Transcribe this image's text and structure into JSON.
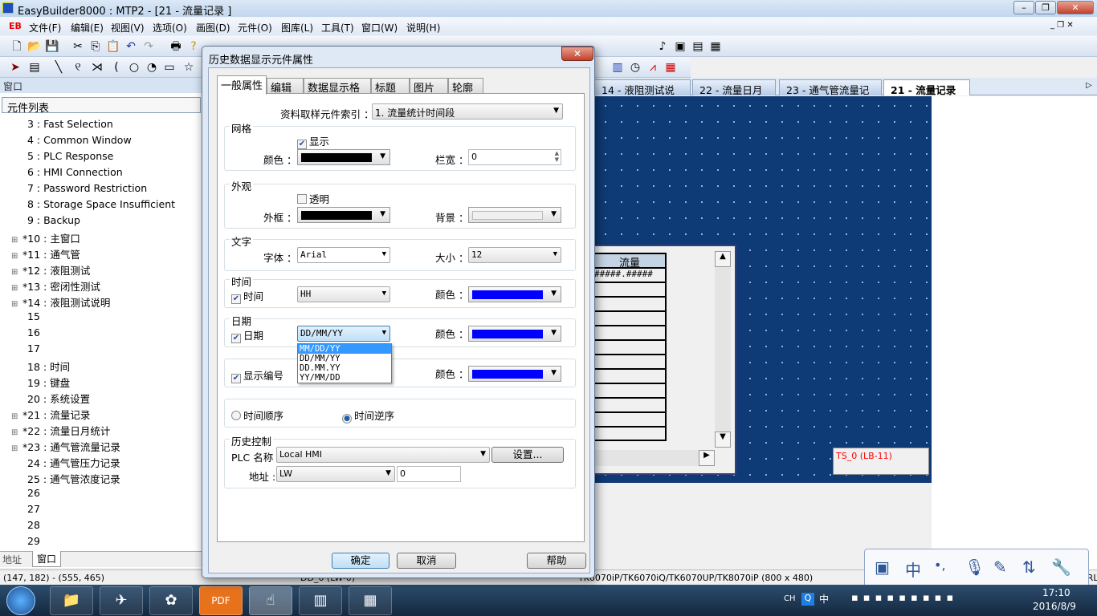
{
  "app": {
    "title": "EasyBuilder8000 : MTP2 - [21 - 流量记录 ]",
    "win_min": "–",
    "win_restore": "❐",
    "win_close": "✕",
    "logo": "EB"
  },
  "menu": [
    "文件(F)",
    "编辑(E)",
    "视图(V)",
    "选项(O)",
    "画图(D)",
    "元件(O)",
    "图库(L)",
    "工具(T)",
    "窗口(W)",
    "说明(H)"
  ],
  "left_panel": {
    "header": "窗口",
    "subheader": "元件列表",
    "bottom_tabs": [
      "地址",
      "窗口"
    ],
    "tree": [
      {
        "label": "3 : Fast Selection",
        "exp": false
      },
      {
        "label": "4 : Common Window",
        "exp": false
      },
      {
        "label": "5 : PLC Response",
        "exp": false
      },
      {
        "label": "6 : HMI Connection",
        "exp": false
      },
      {
        "label": "7 : Password Restriction",
        "exp": false
      },
      {
        "label": "8 : Storage Space Insufficient",
        "exp": false
      },
      {
        "label": "9 : Backup",
        "exp": false
      },
      {
        "label": "*10 : 主窗口",
        "exp": true
      },
      {
        "label": "*11 : 通气管",
        "exp": true
      },
      {
        "label": "*12 : 液阻测试",
        "exp": true
      },
      {
        "label": "*13 : 密闭性测试",
        "exp": true
      },
      {
        "label": "*14 : 液阻测试说明",
        "exp": true
      },
      {
        "label": "15",
        "exp": false
      },
      {
        "label": "16",
        "exp": false
      },
      {
        "label": "17",
        "exp": false
      },
      {
        "label": "18 : 时间",
        "exp": false
      },
      {
        "label": "19 : 键盘",
        "exp": false
      },
      {
        "label": "20 : 系统设置",
        "exp": false
      },
      {
        "label": "*21 : 流量记录",
        "exp": true
      },
      {
        "label": "*22 : 流量日月统计",
        "exp": true
      },
      {
        "label": "*23 : 通气管流量记录",
        "exp": true
      },
      {
        "label": "24 : 通气管压力记录",
        "exp": false
      },
      {
        "label": "25 : 通气管浓度记录",
        "exp": false
      },
      {
        "label": "26",
        "exp": false
      },
      {
        "label": "27",
        "exp": false
      },
      {
        "label": "28",
        "exp": false
      },
      {
        "label": "29",
        "exp": false
      }
    ]
  },
  "doc_tabs": [
    "14 - 液阻测试说明",
    "22 - 流量日月统计",
    "23 - 通气管流量记录",
    "21 - 流量记录"
  ],
  "doc_tab_close": "✕",
  "canvas": {
    "table_header": "流量",
    "table_value": "#####.#####",
    "ts_label": "TS_0 (LB-11)",
    "ts_color": "#ff0000",
    "bg": "#0e3a75"
  },
  "dialog": {
    "title": "历史数据显示元件属性",
    "close": "✕",
    "tabs": [
      "一般属性",
      "编辑",
      "数据显示格式",
      "标题",
      "图片",
      "轮廓"
    ],
    "sampling_label": "资料取样元件索引 ：",
    "sampling_value": "1.  流量统计时间段",
    "grid": {
      "title": "网格",
      "show": "显示",
      "show_checked": true,
      "color_label": "颜色 ：",
      "color": "#000000",
      "width_label": "栏宽 ：",
      "width_value": "0"
    },
    "appearance": {
      "title": "外观",
      "transparent": "透明",
      "transparent_checked": false,
      "frame_label": "外框 ：",
      "frame_color": "#000000",
      "bg_label": "背景 ：",
      "bg_color": "#f0f0f0"
    },
    "text": {
      "title": "文字",
      "font_label": "字体 ：",
      "font_value": "Arial",
      "size_label": "大小 ：",
      "size_value": "12"
    },
    "time": {
      "title": "时间",
      "check": "时间",
      "checked": true,
      "format": "HH",
      "color_label": "颜色 ：",
      "color": "#0000ff"
    },
    "date": {
      "title": "日期",
      "check": "日期",
      "checked": true,
      "format": "DD/MM/YY",
      "color_label": "颜色 ：",
      "color": "#0000ff",
      "options": [
        "MM/DD/YY",
        "DD/MM/YY",
        "DD.MM.YY",
        "YY/MM/DD"
      ],
      "highlighted": "MM/DD/YY"
    },
    "number": {
      "check": "显示编号",
      "checked": true,
      "color_label": "颜色 ：",
      "color": "#0000ff"
    },
    "order": {
      "asc": "时间顺序",
      "desc": "时间逆序",
      "selected": "时间逆序"
    },
    "history": {
      "title": "历史控制",
      "plc_label": "PLC 名称 :",
      "plc_value": "Local HMI",
      "settings_btn": "设置...",
      "addr_label": "地址 :",
      "addr_type": "LW",
      "addr_value": "0"
    },
    "ok": "确定",
    "cancel": "取消",
    "help": "帮助"
  },
  "status": {
    "coords": "(147, 182) - (555, 465)",
    "mid": "DD_0 (LW-0)",
    "model": "TK6070iP/TK6070iQ/TK6070UP/TK8070iP (800 x 480)",
    "right": "CRL"
  },
  "ime": [
    "中",
    "•,"
  ],
  "taskbar": {
    "lang": "CH",
    "ime": "中",
    "time": "17:10",
    "date": "2016/8/9"
  }
}
